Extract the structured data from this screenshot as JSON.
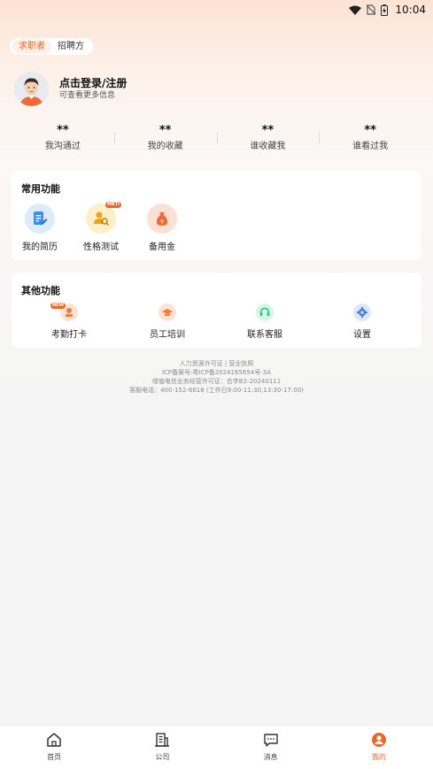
{
  "status_bar": {
    "time": "10:04"
  },
  "role_toggle": {
    "active": "求职者",
    "inactive": "招聘方"
  },
  "profile": {
    "title": "点击登录/注册",
    "subtitle": "可查看更多信息"
  },
  "stats": [
    {
      "value": "**",
      "label": "我沟通过"
    },
    {
      "value": "**",
      "label": "我的收藏"
    },
    {
      "value": "**",
      "label": "谁收藏我"
    },
    {
      "value": "**",
      "label": "谁看过我"
    }
  ],
  "common_functions": {
    "title": "常用功能",
    "items": [
      {
        "label": "我的简历",
        "icon": "resume-icon",
        "color": "#3a8ee6"
      },
      {
        "label": "性格测试",
        "icon": "personality-test-icon",
        "color": "#f0a21b",
        "badge": "MBTI"
      },
      {
        "label": "备用金",
        "icon": "money-bag-icon",
        "color": "#ef6a3a"
      }
    ]
  },
  "other_functions": {
    "title": "其他功能",
    "items": [
      {
        "label": "考勤打卡",
        "icon": "attendance-icon",
        "color": "#ef7a3a",
        "badge": "NEW"
      },
      {
        "label": "员工培训",
        "icon": "training-cap-icon",
        "color": "#ef7a3a"
      },
      {
        "label": "联系客服",
        "icon": "headset-icon",
        "color": "#27c282"
      },
      {
        "label": "设置",
        "icon": "settings-gear-icon",
        "color": "#4a7ee6"
      }
    ]
  },
  "footer_info": {
    "line1": "人力资源许可证 | 营业执照",
    "line2": "ICP备案号:粤ICP备2024165654号-3A",
    "line3": "增值电信业务经营许可证：合字B2-20240111",
    "line4": "客服电话：400-152-6618 (工作日9:00-11:30,13:30-17:00)"
  },
  "tab_bar": {
    "items": [
      {
        "label": "首页",
        "icon": "home-icon"
      },
      {
        "label": "公司",
        "icon": "company-icon"
      },
      {
        "label": "消息",
        "icon": "message-icon"
      },
      {
        "label": "我的",
        "icon": "profile-icon",
        "active": true
      }
    ]
  },
  "colors": {
    "accent": "#e8672a",
    "background": "#f5f5f5"
  }
}
